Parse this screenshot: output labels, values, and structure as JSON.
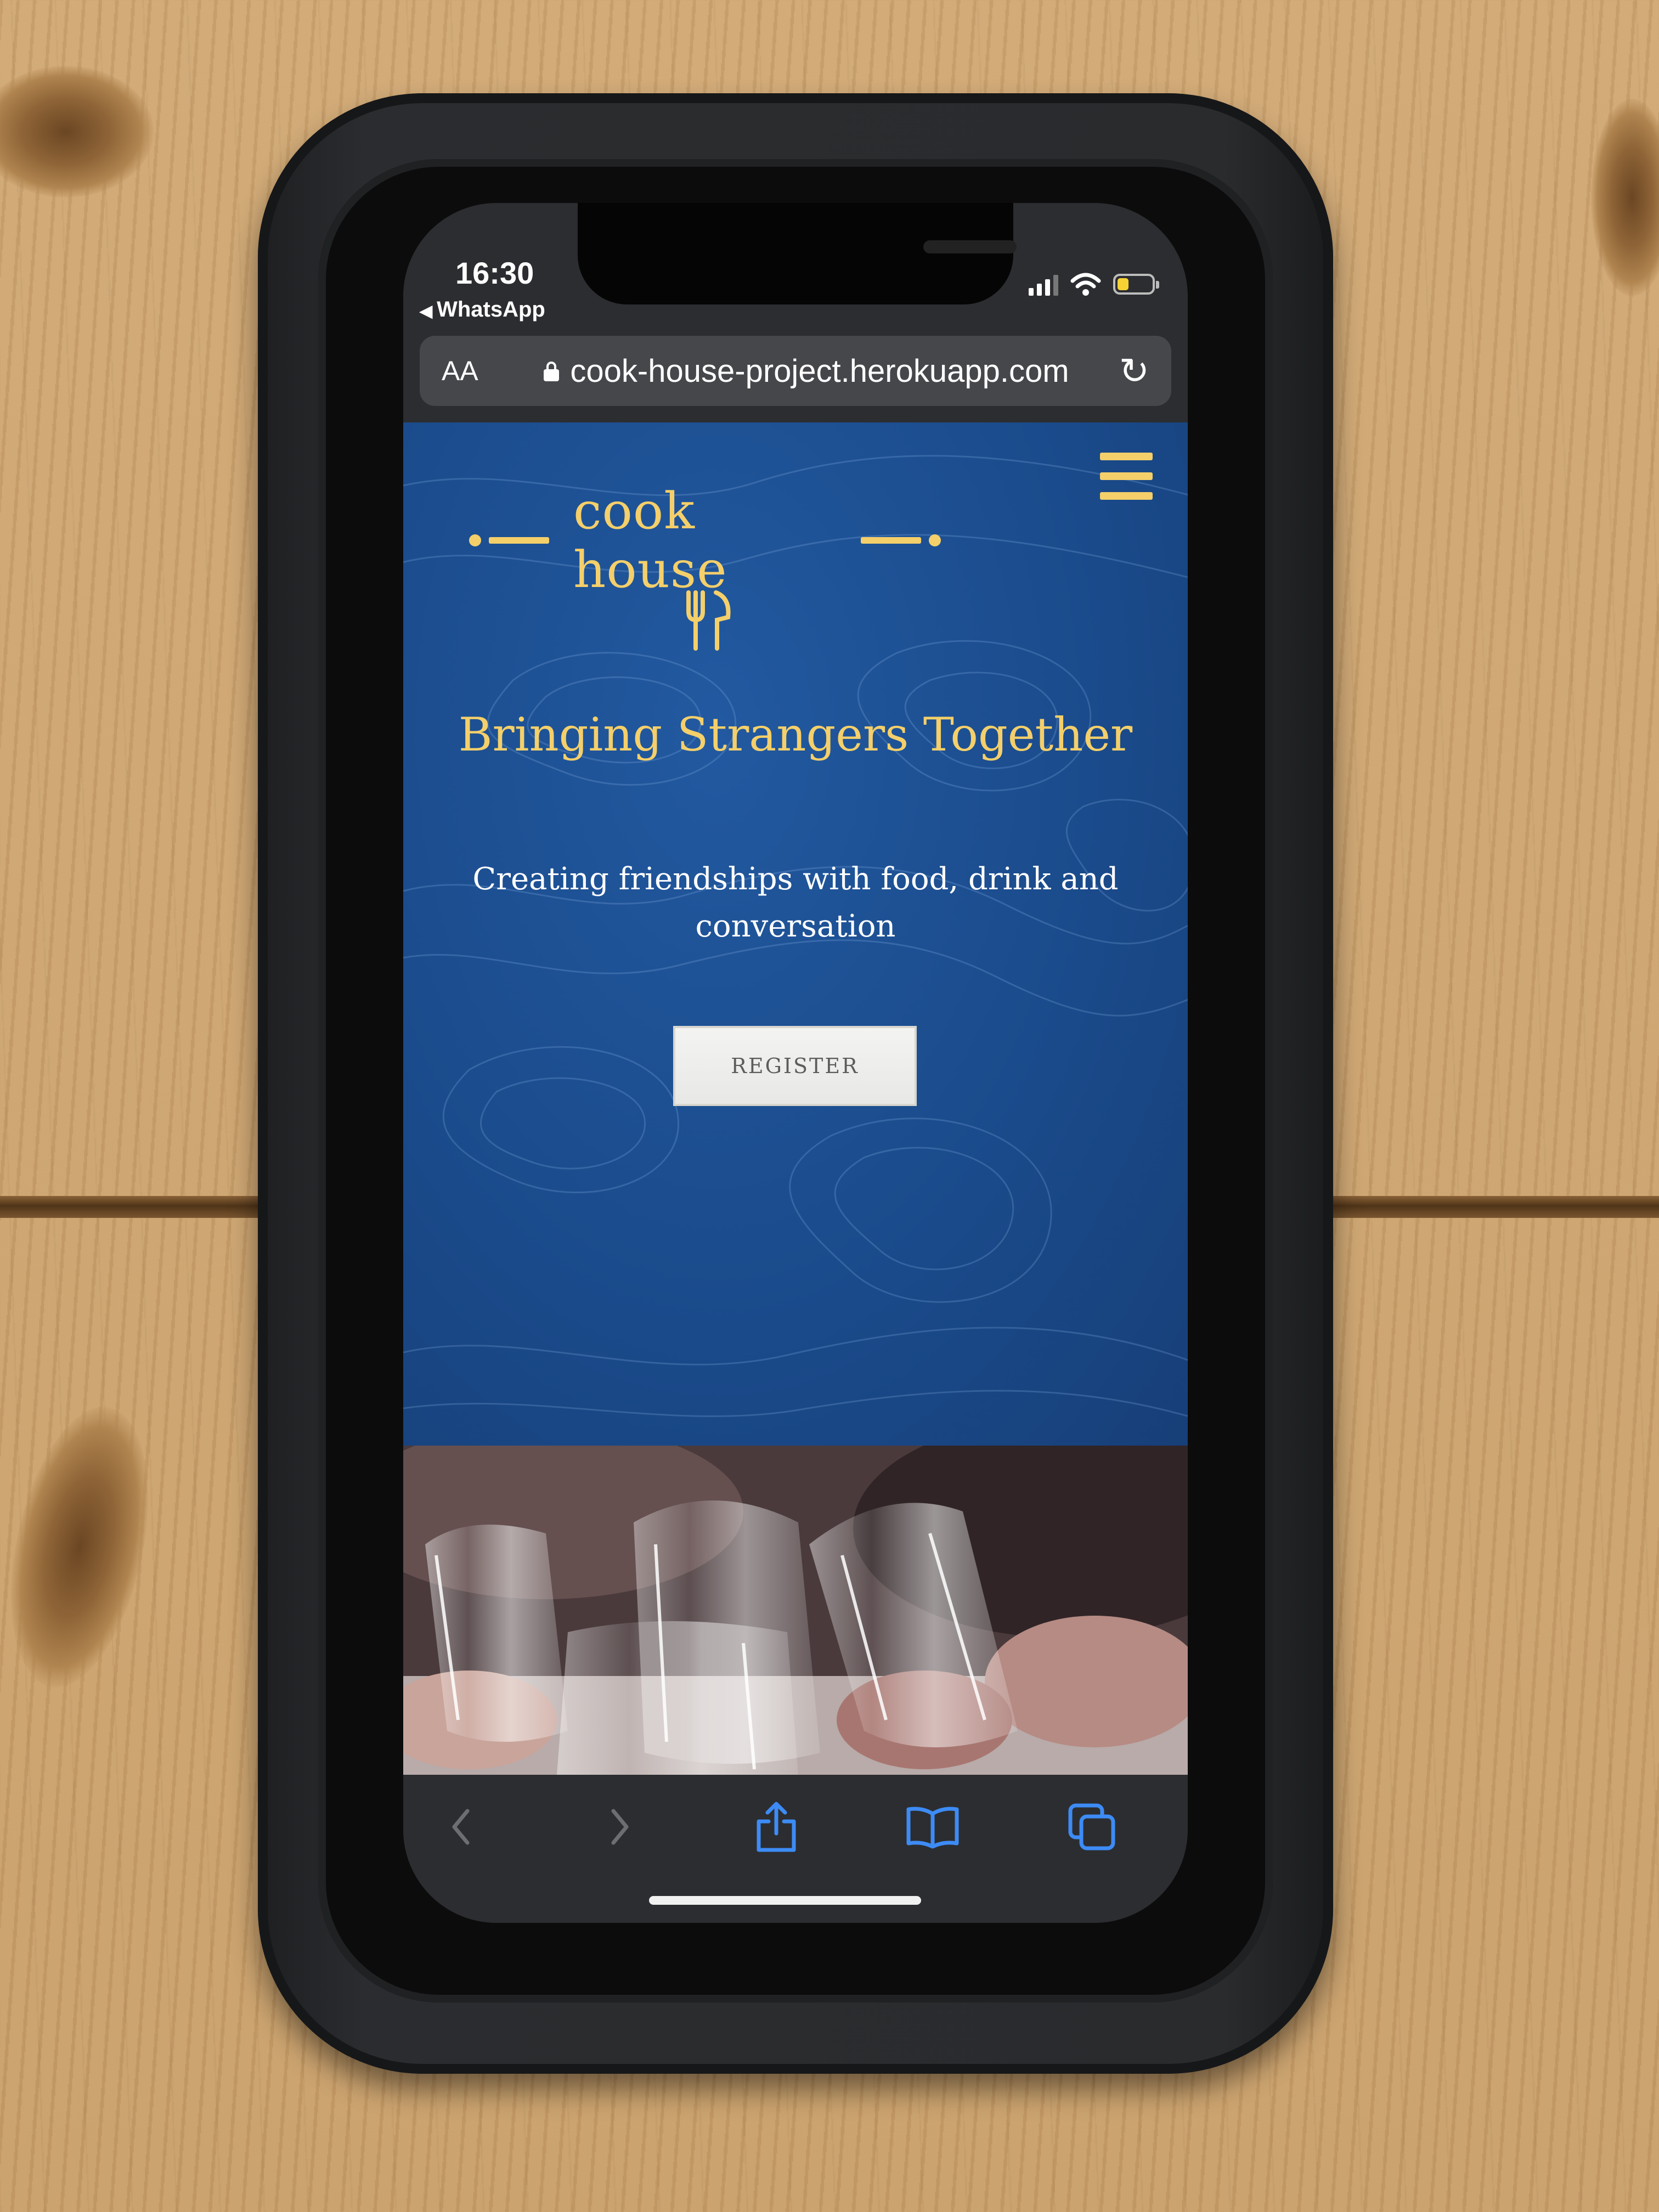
{
  "status_bar": {
    "time": "16:30",
    "back_app": "WhatsApp",
    "battery_level": 0.3,
    "battery_color": "#f7d234"
  },
  "browser": {
    "text_size_label": "AA",
    "url": "cook-house-project.herokuapp.com",
    "lock_icon": "lock-icon",
    "reload_icon": "reload-icon"
  },
  "site": {
    "logo_text": "cook house",
    "logo_icon": "fork-knife-icon",
    "menu_icon": "hamburger-menu-icon",
    "headline": "Bringing Strangers Together",
    "subheadline": "Creating friendships with food, drink and conversation",
    "register_label": "REGISTER",
    "hero_image_alt": "wine-glasses-toast-photo",
    "accent_color": "#f4cf6a",
    "hero_color": "#1a4a8a"
  },
  "toolbar": {
    "icons": [
      "back-icon",
      "forward-icon",
      "share-icon",
      "bookmarks-icon",
      "tabs-icon"
    ],
    "accent_color": "#3d8bf5"
  }
}
